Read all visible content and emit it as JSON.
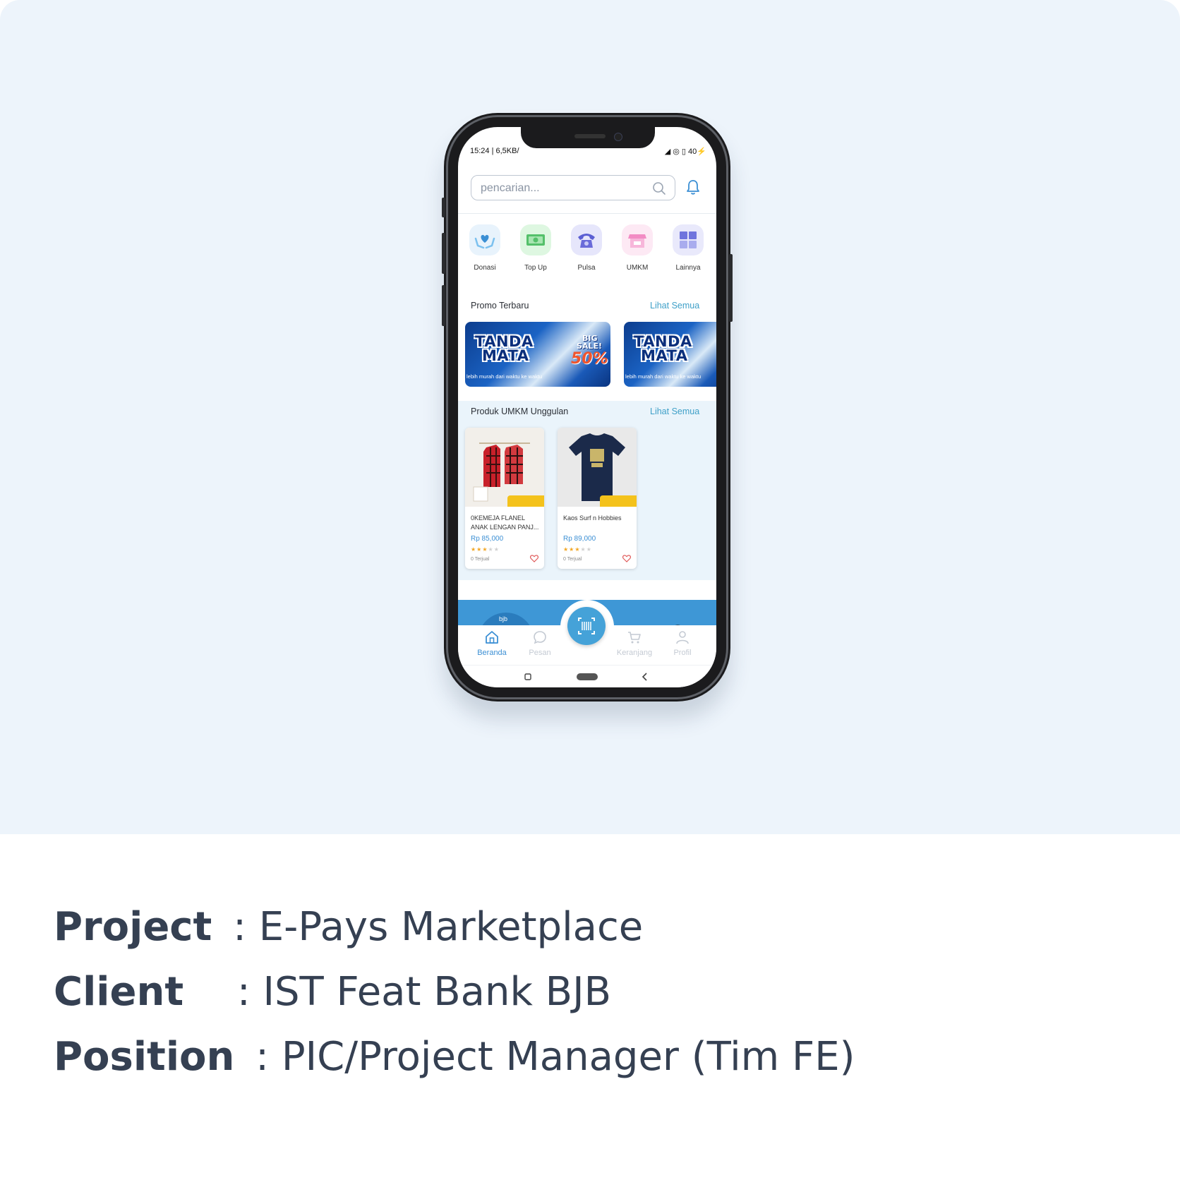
{
  "caption": {
    "project_key": "Project",
    "project_value": ": E-Pays Marketplace",
    "client_key": "Client",
    "client_value": ": IST Feat Bank BJB",
    "position_key": "Position",
    "position_value": ": PIC/Project Manager (Tim FE)"
  },
  "phone": {
    "status_left": "15:24 | 6,5KB/",
    "status_right": "40",
    "search_placeholder": "pencarian...",
    "categories": [
      {
        "label": "Donasi",
        "icon": "donation-hands-icon",
        "bg": "#e8f3fc",
        "color": "#5aa9e6"
      },
      {
        "label": "Top Up",
        "icon": "money-icon",
        "bg": "#def7e1",
        "color": "#54c06a"
      },
      {
        "label": "Pulsa",
        "icon": "phone-icon",
        "bg": "#e6e6fb",
        "color": "#6a6bd9"
      },
      {
        "label": "UMKM",
        "icon": "store-icon",
        "bg": "#fde9f4",
        "color": "#f28cc4"
      },
      {
        "label": "Lainnya",
        "icon": "grid-icon",
        "bg": "#e9e9fb",
        "color": "#7a7fe0"
      }
    ],
    "promo": {
      "title": "Promo Terbaru",
      "link": "Lihat Semua",
      "banners": [
        {
          "brand_line1": "TANDA",
          "brand_line2": "MATA",
          "tagline": "lebih murah dari waktu ke waktu",
          "sale_line1": "BIG",
          "sale_line2": "SALE!",
          "discount": "50%"
        },
        {
          "brand_line1": "TANDA",
          "brand_line2": "MATA",
          "tagline": "lebih murah dari waktu ke waktu"
        }
      ]
    },
    "umkm": {
      "title": "Produk UMKM Unggulan",
      "link": "Lihat Semua",
      "products": [
        {
          "name": "0KEMEJA FLANEL ANAK LENGAN PANJ...",
          "price": "Rp 85,000",
          "rating": 3,
          "sold": "0 Terjual"
        },
        {
          "name": "Kaos Surf n Hobbies",
          "price": "Rp 89,000",
          "rating": 3,
          "sold": "0 Terjual"
        }
      ]
    },
    "promo_strip_label": "bjb",
    "tabs": {
      "home": "Beranda",
      "messages": "Pesan",
      "cart": "Keranjang",
      "profile": "Profil"
    },
    "colors": {
      "accent": "#3b8fd4",
      "hero_bg": "#edf4fb",
      "caption_text": "#354052"
    }
  }
}
